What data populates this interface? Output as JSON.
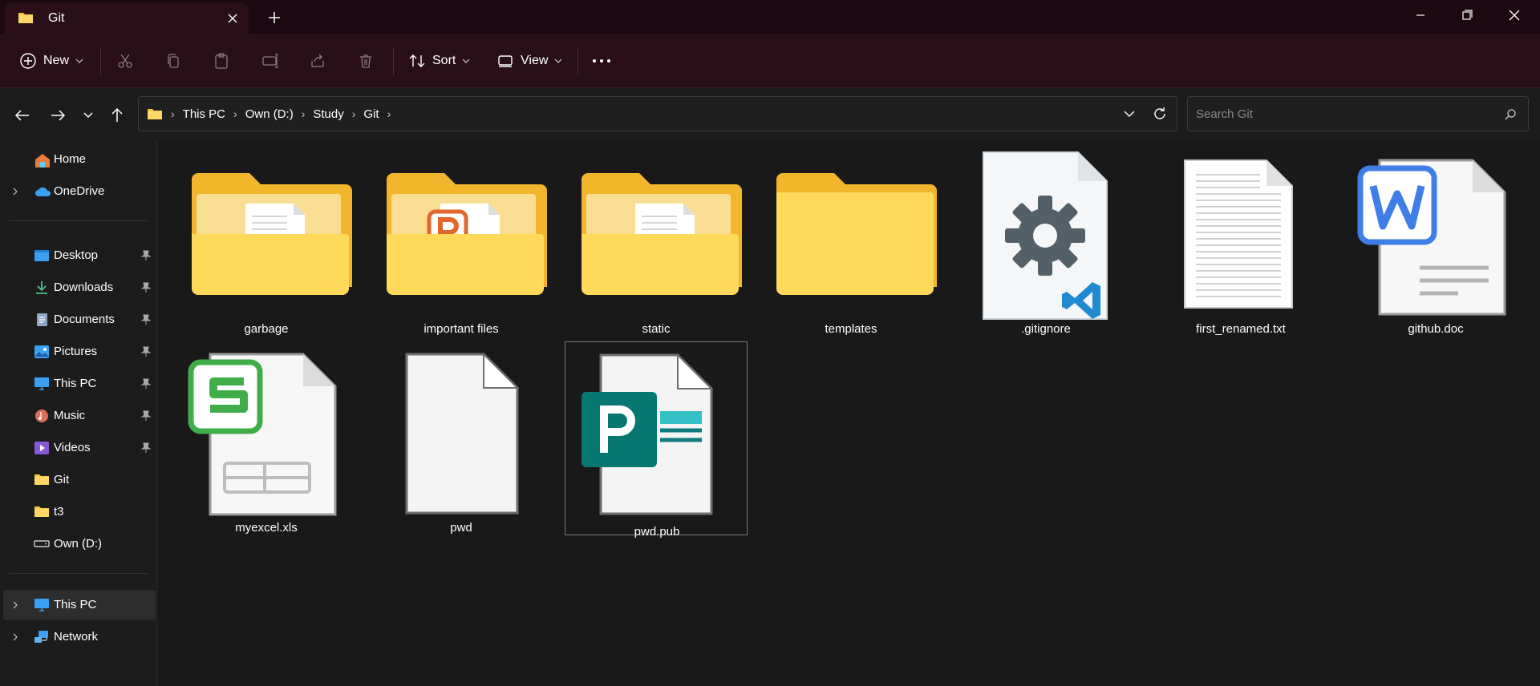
{
  "window": {
    "tab_title": "Git"
  },
  "toolbar": {
    "new_label": "New",
    "sort_label": "Sort",
    "view_label": "View"
  },
  "address": {
    "crumbs": [
      "This PC",
      "Own (D:)",
      "Study",
      "Git"
    ],
    "search_placeholder": "Search Git"
  },
  "sidebar": {
    "home": "Home",
    "onedrive": "OneDrive",
    "pinned": [
      "Desktop",
      "Downloads",
      "Documents",
      "Pictures",
      "This PC",
      "Music",
      "Videos"
    ],
    "folders": [
      "Git",
      "t3",
      "Own (D:)"
    ],
    "this_pc": "This PC",
    "network": "Network"
  },
  "files": [
    {
      "name": "garbage",
      "type": "folder-docs"
    },
    {
      "name": "important files",
      "type": "folder-ppt"
    },
    {
      "name": "static",
      "type": "folder-docs"
    },
    {
      "name": "templates",
      "type": "folder-empty"
    },
    {
      "name": ".gitignore",
      "type": "vscode-config"
    },
    {
      "name": "first_renamed.txt",
      "type": "text"
    },
    {
      "name": "github.doc",
      "type": "word"
    },
    {
      "name": "myexcel.xls",
      "type": "spreadsheet"
    },
    {
      "name": "pwd",
      "type": "blank"
    },
    {
      "name": "pwd.pub",
      "type": "publisher"
    }
  ],
  "colors": {
    "titlebar": "#1d0710",
    "commandbar": "#2a0f19",
    "folder": "#f8c84a",
    "accent": "#60cdff"
  }
}
